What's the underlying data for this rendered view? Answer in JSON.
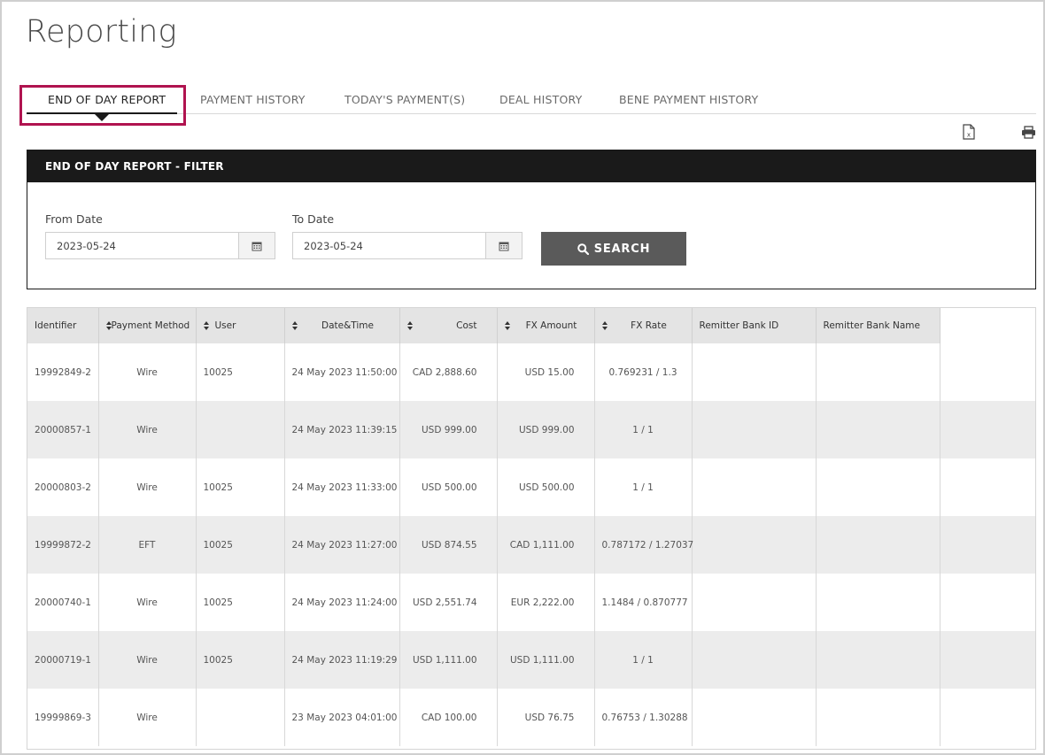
{
  "page": {
    "title": "Reporting"
  },
  "tabs": [
    {
      "label": "END OF DAY REPORT",
      "active": true
    },
    {
      "label": "PAYMENT HISTORY",
      "active": false
    },
    {
      "label": "TODAY'S PAYMENT(S)",
      "active": false
    },
    {
      "label": "DEAL HISTORY",
      "active": false
    },
    {
      "label": "BENE PAYMENT HISTORY",
      "active": false
    }
  ],
  "toolbar": {
    "export_icon": "excel-export-icon",
    "print_icon": "print-icon"
  },
  "filter": {
    "header": "END OF DAY REPORT - FILTER",
    "from_label": "From Date",
    "from_value": "2023-05-24",
    "to_label": "To Date",
    "to_value": "2023-05-24",
    "search_label": "SEARCH"
  },
  "table": {
    "columns": [
      "Identifier",
      "Payment Method",
      "User",
      "Date&Time",
      "Cost",
      "FX Amount",
      "FX Rate",
      "Remitter Bank ID",
      "Remitter Bank Name"
    ],
    "rows": [
      {
        "id": "19992849-2",
        "method": "Wire",
        "user": "10025",
        "datetime": "24 May 2023 11:50:00",
        "cost": "CAD 2,888.60",
        "fx_amount": "USD 15.00",
        "fx_rate": "0.769231 / 1.3",
        "bank_id": "",
        "bank_name": ""
      },
      {
        "id": "20000857-1",
        "method": "Wire",
        "user": "",
        "datetime": "24 May 2023 11:39:15",
        "cost": "USD 999.00",
        "fx_amount": "USD 999.00",
        "fx_rate": "1 / 1",
        "bank_id": "",
        "bank_name": ""
      },
      {
        "id": "20000803-2",
        "method": "Wire",
        "user": "10025",
        "datetime": "24 May 2023 11:33:00",
        "cost": "USD 500.00",
        "fx_amount": "USD 500.00",
        "fx_rate": "1 / 1",
        "bank_id": "",
        "bank_name": ""
      },
      {
        "id": "19999872-2",
        "method": "EFT",
        "user": "10025",
        "datetime": "24 May 2023 11:27:00",
        "cost": "USD 874.55",
        "fx_amount": "CAD 1,111.00",
        "fx_rate": "0.787172 / 1.27037",
        "bank_id": "",
        "bank_name": ""
      },
      {
        "id": "20000740-1",
        "method": "Wire",
        "user": "10025",
        "datetime": "24 May 2023 11:24:00",
        "cost": "USD 2,551.74",
        "fx_amount": "EUR 2,222.00",
        "fx_rate": "1.1484 / 0.870777",
        "bank_id": "",
        "bank_name": ""
      },
      {
        "id": "20000719-1",
        "method": "Wire",
        "user": "10025",
        "datetime": "24 May 2023 11:19:29",
        "cost": "USD 1,111.00",
        "fx_amount": "USD 1,111.00",
        "fx_rate": "1 / 1",
        "bank_id": "",
        "bank_name": ""
      },
      {
        "id": "19999869-3",
        "method": "Wire",
        "user": "",
        "datetime": "23 May 2023 04:01:00",
        "cost": "CAD 100.00",
        "fx_amount": "USD 76.75",
        "fx_rate": "0.76753 / 1.30288",
        "bank_id": "",
        "bank_name": ""
      }
    ]
  },
  "colors": {
    "highlight": "#b0134f",
    "header_bg": "#1a1a1a",
    "search_bg": "#5a5a5a",
    "row_alt": "#ececec"
  }
}
